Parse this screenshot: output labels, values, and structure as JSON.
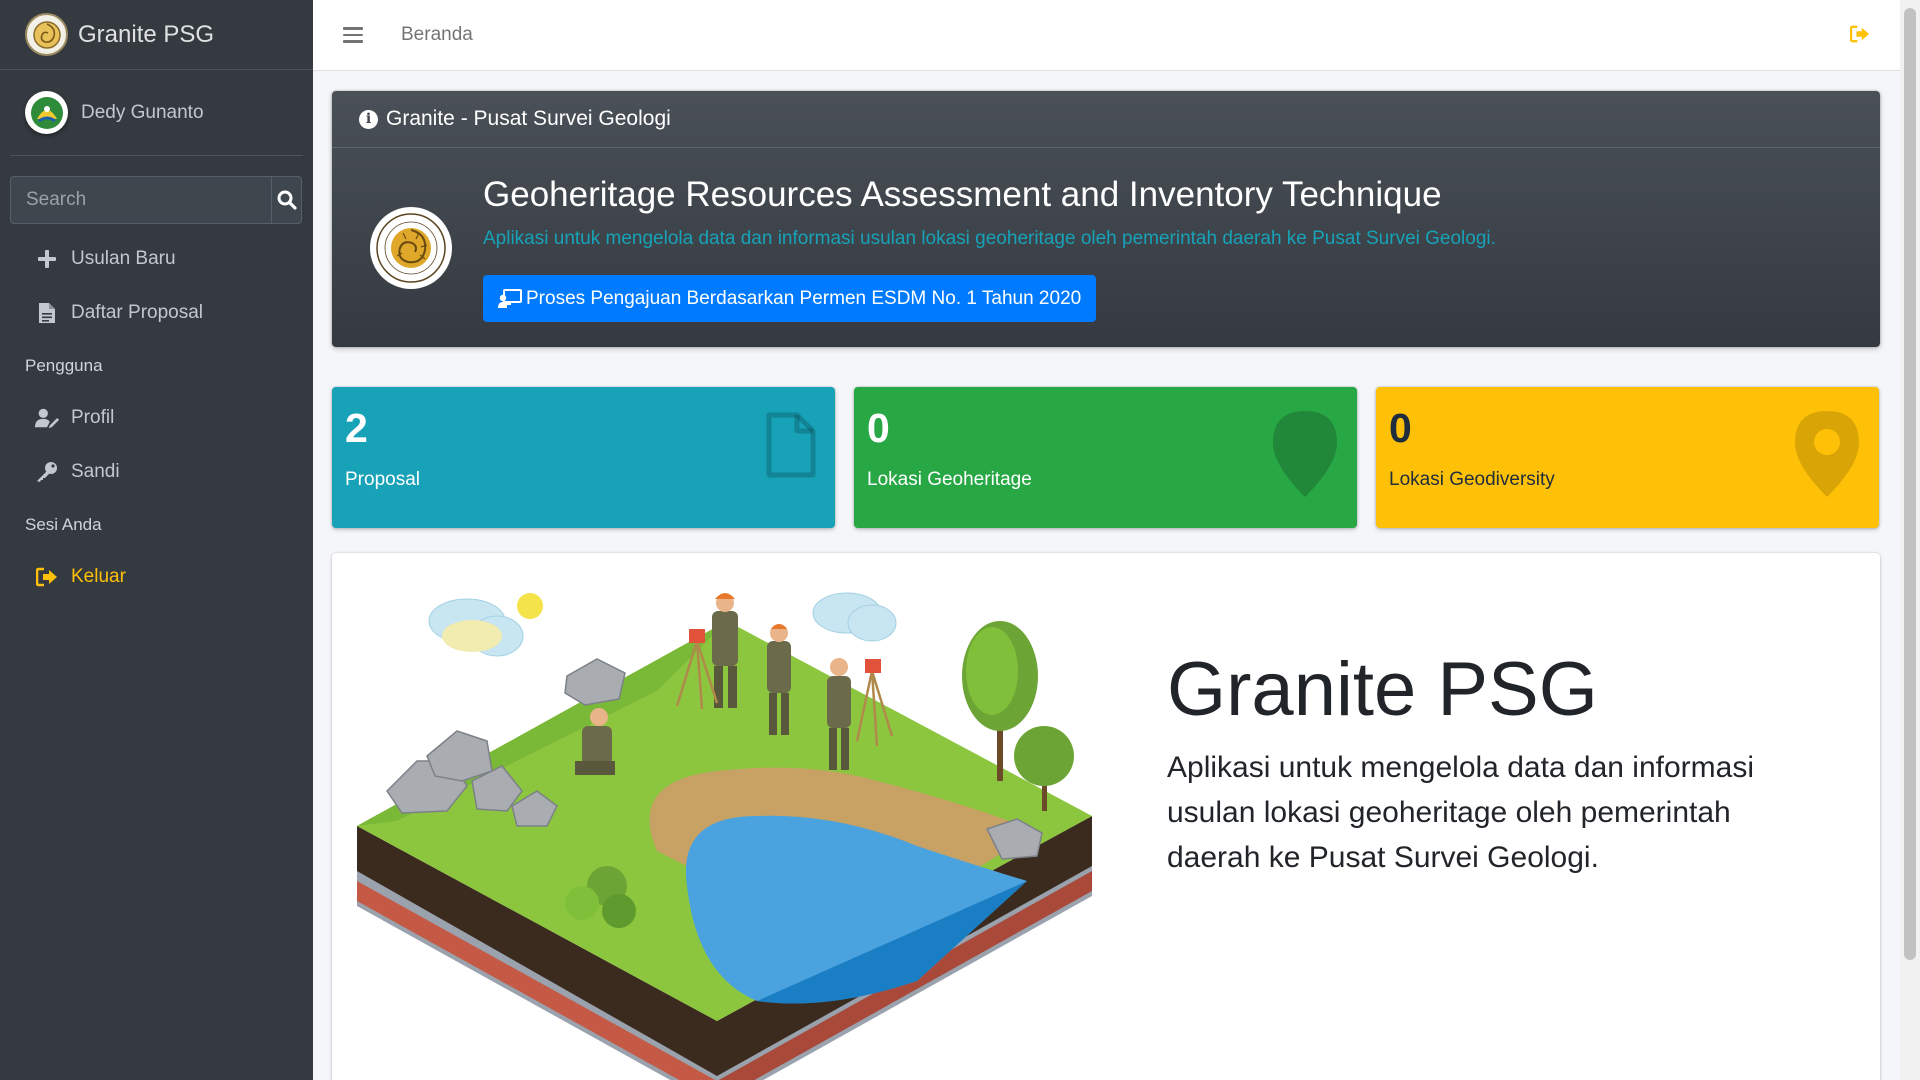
{
  "app": {
    "brand": "Granite PSG"
  },
  "user": {
    "name": "Dedy Gunanto"
  },
  "search": {
    "placeholder": "Search"
  },
  "nav": {
    "items_main": [
      {
        "label": "Usulan Baru",
        "icon": "plus-icon"
      },
      {
        "label": "Daftar Proposal",
        "icon": "file-icon"
      }
    ],
    "header_user": "Pengguna",
    "items_user": [
      {
        "label": "Profil",
        "icon": "user-edit-icon"
      },
      {
        "label": "Sandi",
        "icon": "key-icon"
      }
    ],
    "header_session": "Sesi Anda",
    "logout": {
      "label": "Keluar",
      "icon": "sign-out-icon",
      "color": "#ffc107"
    }
  },
  "topbar": {
    "breadcrumb": "Beranda"
  },
  "hero": {
    "header": "Granite - Pusat Survei Geologi",
    "title": "Geoheritage Resources Assessment and Inventory Technique",
    "subtitle": "Aplikasi untuk mengelola data dan informasi usulan lokasi geoheritage oleh pemerintah daerah ke Pusat Survei Geologi.",
    "button": "Proses Pengajuan Berdasarkan Permen ESDM No. 1 Tahun 2020"
  },
  "stats": [
    {
      "count": "2",
      "label": "Proposal",
      "color": "#17a2b8",
      "icon": "file-icon"
    },
    {
      "count": "0",
      "label": "Lokasi Geoheritage",
      "color": "#28a745",
      "icon": "map-marker-icon"
    },
    {
      "count": "0",
      "label": "Lokasi Geodiversity",
      "color": "#ffc107",
      "icon": "map-marker-alt-icon"
    }
  ],
  "content": {
    "title": "Granite PSG",
    "description": "Aplikasi untuk mengelola data dan informasi usulan lokasi geoheritage oleh pemerintah daerah ke Pusat Survei Geologi."
  },
  "colors": {
    "sidebar": "#343a40",
    "primary": "#007bff",
    "info": "#17a2b8",
    "success": "#28a745",
    "warning": "#ffc107"
  }
}
